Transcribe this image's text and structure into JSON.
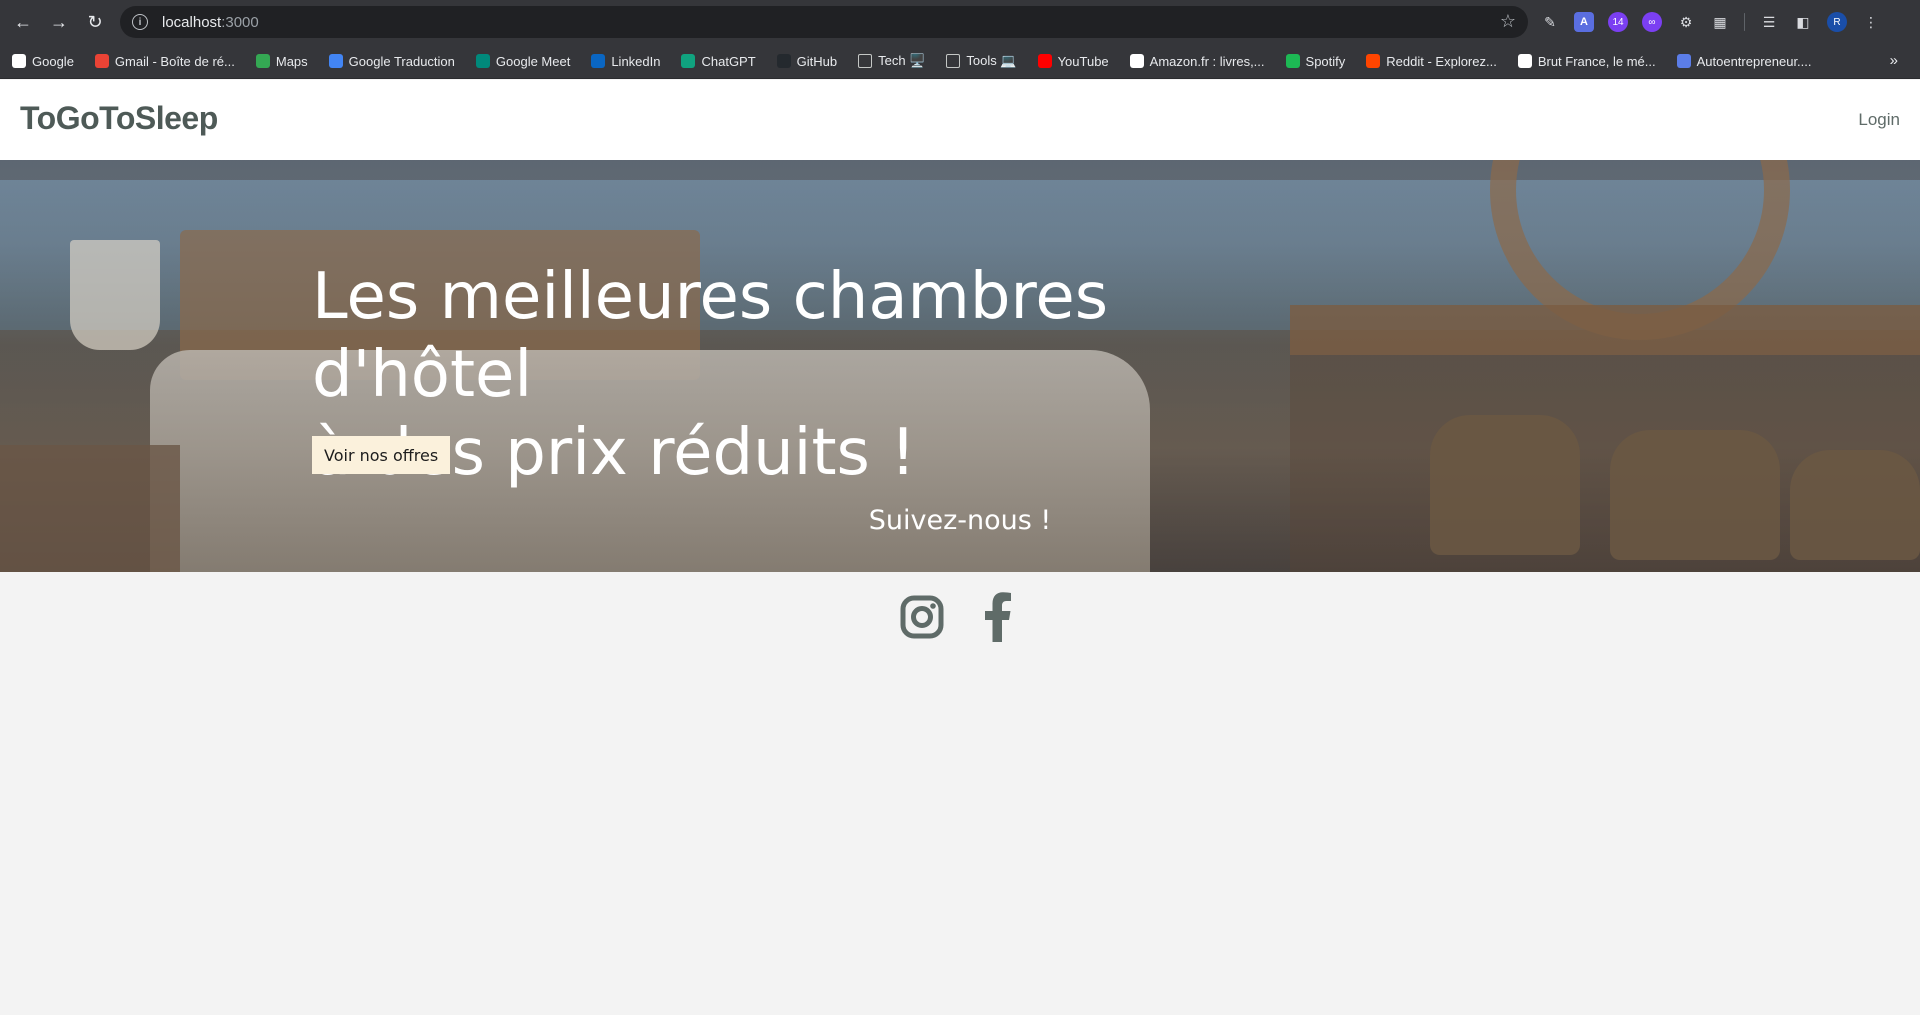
{
  "browser": {
    "url_host": "localhost",
    "url_port": ":3000",
    "extension_badge": "14",
    "profile_initial": "R",
    "bookmarks": [
      {
        "label": "Google",
        "icon": "google-icon",
        "color": "#ffffff"
      },
      {
        "label": "Gmail - Boîte de ré...",
        "icon": "gmail-icon",
        "color": "#ea4335"
      },
      {
        "label": "Maps",
        "icon": "maps-icon",
        "color": "#34a853"
      },
      {
        "label": "Google Traduction",
        "icon": "translate-icon",
        "color": "#4285f4"
      },
      {
        "label": "Google Meet",
        "icon": "meet-icon",
        "color": "#00897b"
      },
      {
        "label": "LinkedIn",
        "icon": "linkedin-icon",
        "color": "#0a66c2"
      },
      {
        "label": "ChatGPT",
        "icon": "chatgpt-icon",
        "color": "#10a37f"
      },
      {
        "label": "GitHub",
        "icon": "github-icon",
        "color": "#24292e"
      },
      {
        "label": "Tech 🖥️",
        "icon": "folder-icon",
        "color": "#35363a"
      },
      {
        "label": "Tools 💻",
        "icon": "folder-icon",
        "color": "#35363a"
      },
      {
        "label": "YouTube",
        "icon": "youtube-icon",
        "color": "#ff0000"
      },
      {
        "label": "Amazon.fr : livres,...",
        "icon": "amazon-icon",
        "color": "#ffffff"
      },
      {
        "label": "Spotify",
        "icon": "spotify-icon",
        "color": "#1db954"
      },
      {
        "label": "Reddit - Explorez...",
        "icon": "reddit-icon",
        "color": "#ff4500"
      },
      {
        "label": "Brut France, le mé...",
        "icon": "brut-icon",
        "color": "#ffffff"
      },
      {
        "label": "Autoentrepreneur....",
        "icon": "autoentrepreneur-icon",
        "color": "#5b7de8"
      }
    ]
  },
  "header": {
    "brand": "ToGoToSleep",
    "login_label": "Login"
  },
  "hero": {
    "title_line1": "Les meilleures chambres d'hôtel",
    "title_line2": "à des prix réduits !",
    "cta_label": "Voir nos offres",
    "follow_label": "Suivez-nous !"
  },
  "social": {
    "icon_color": "#5f6b68",
    "items": [
      "instagram-icon",
      "facebook-icon"
    ]
  }
}
